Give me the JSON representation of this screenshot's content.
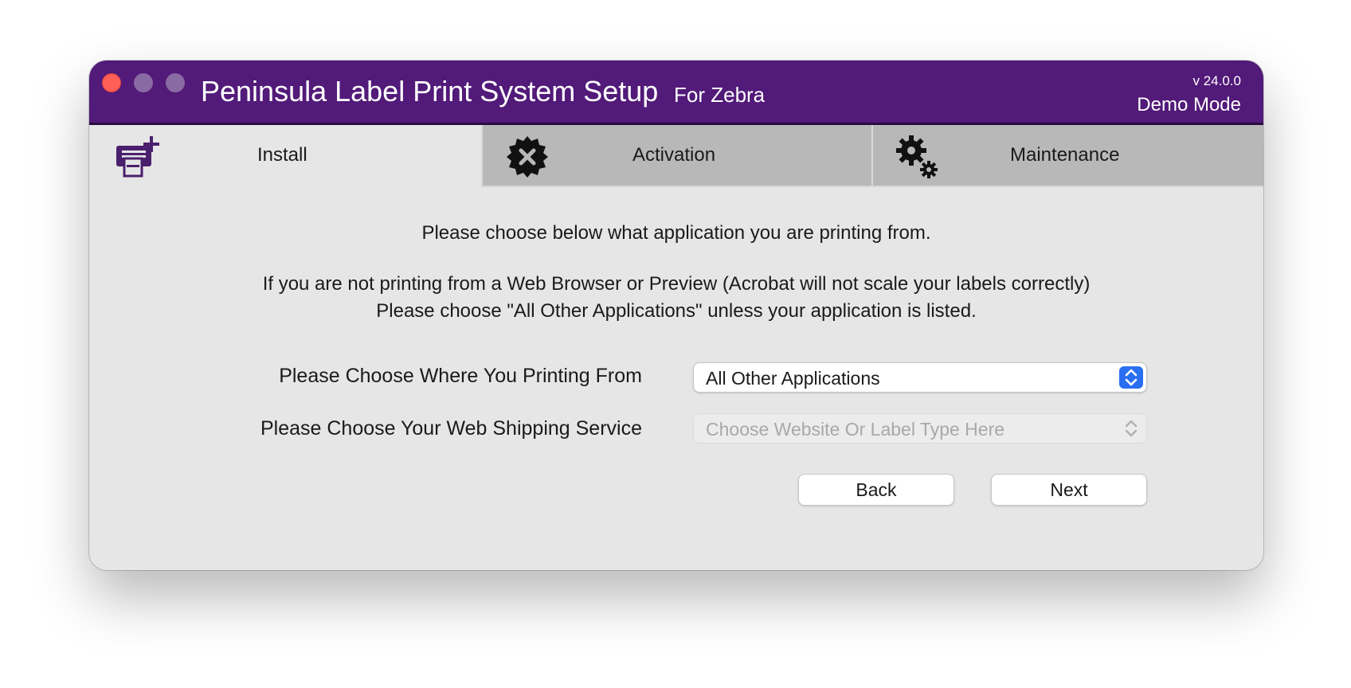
{
  "window": {
    "title": "Peninsula Label Print System Setup",
    "subtitle": "For Zebra",
    "version": "v 24.0.0",
    "mode": "Demo Mode"
  },
  "colors": {
    "titlebar": "#521a79",
    "accent": "#2a6ff2",
    "icon_purple": "#4a1f6e"
  },
  "tabs": [
    {
      "label": "Install",
      "icon": "printer-plus-icon",
      "active": true
    },
    {
      "label": "Activation",
      "icon": "badge-x-icon",
      "active": false
    },
    {
      "label": "Maintenance",
      "icon": "gears-icon",
      "active": false
    }
  ],
  "content": {
    "line1": "Please choose below what application you are printing from.",
    "line2": "If you are not printing from a Web Browser or Preview (Acrobat will not scale your labels correctly)",
    "line3": "Please choose \"All Other Applications\" unless your application is listed."
  },
  "form": {
    "printing_from_label": "Please Choose Where You Printing From",
    "printing_from_value": "All Other Applications",
    "shipping_service_label": "Please Choose Your Web Shipping Service",
    "shipping_service_placeholder": "Choose Website Or Label Type Here"
  },
  "buttons": {
    "back": "Back",
    "next": "Next"
  }
}
